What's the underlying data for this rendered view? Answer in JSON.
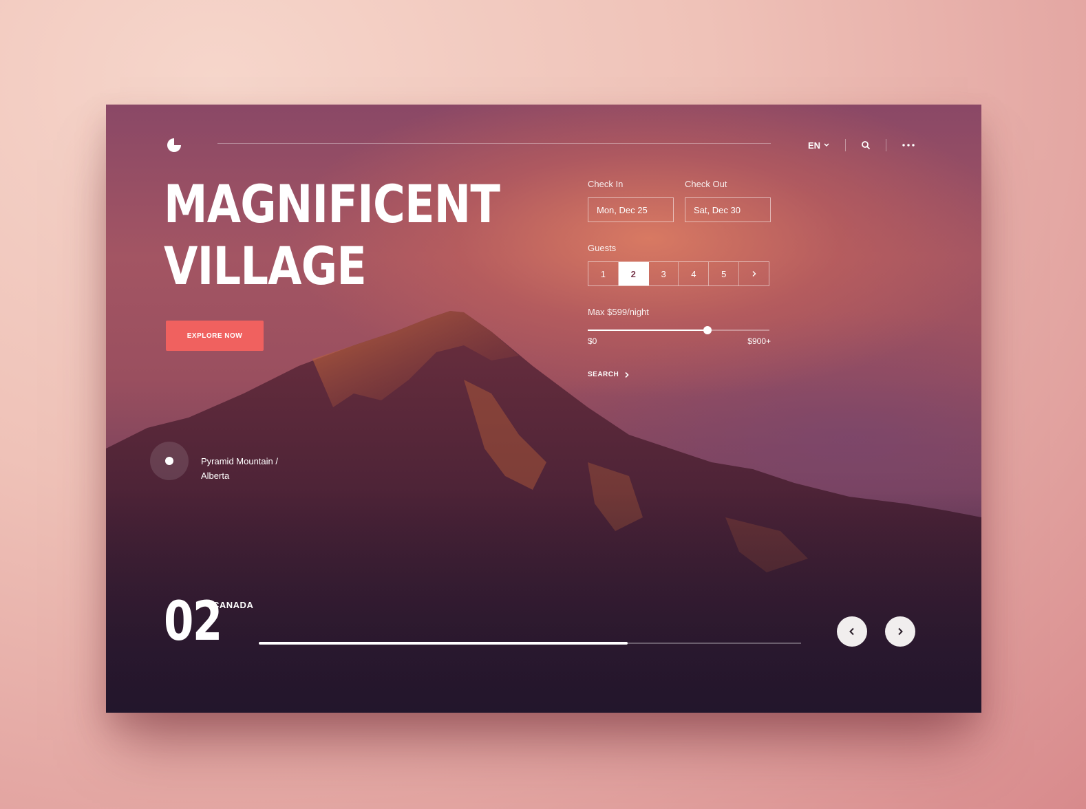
{
  "header": {
    "language": "EN",
    "icons": [
      "logo-icon",
      "chevron-down-icon",
      "search-icon",
      "more-icon"
    ]
  },
  "hero": {
    "title_line1": "MAGNIFICENT",
    "title_line2": "VILLAGE",
    "cta_label": "EXPLORE NOW"
  },
  "booking": {
    "check_in_label": "Check In",
    "check_in_value": "Mon, Dec 25",
    "check_out_label": "Check Out",
    "check_out_value": "Sat, Dec 30",
    "guests_label": "Guests",
    "guest_options": [
      "1",
      "2",
      "3",
      "4",
      "5"
    ],
    "guests_selected": "2",
    "price_label": "Max $599/night",
    "price_min": "$0",
    "price_max": "$900+",
    "price_level_percent": 66,
    "search_label": "SEARCH"
  },
  "location": {
    "name_line1": "Pyramid Mountain /",
    "name_line2": "Alberta"
  },
  "slider": {
    "number": "02",
    "country": "CANADA",
    "progress_percent": 68
  },
  "colors": {
    "accent": "#f0615f",
    "text": "#ffffff"
  }
}
